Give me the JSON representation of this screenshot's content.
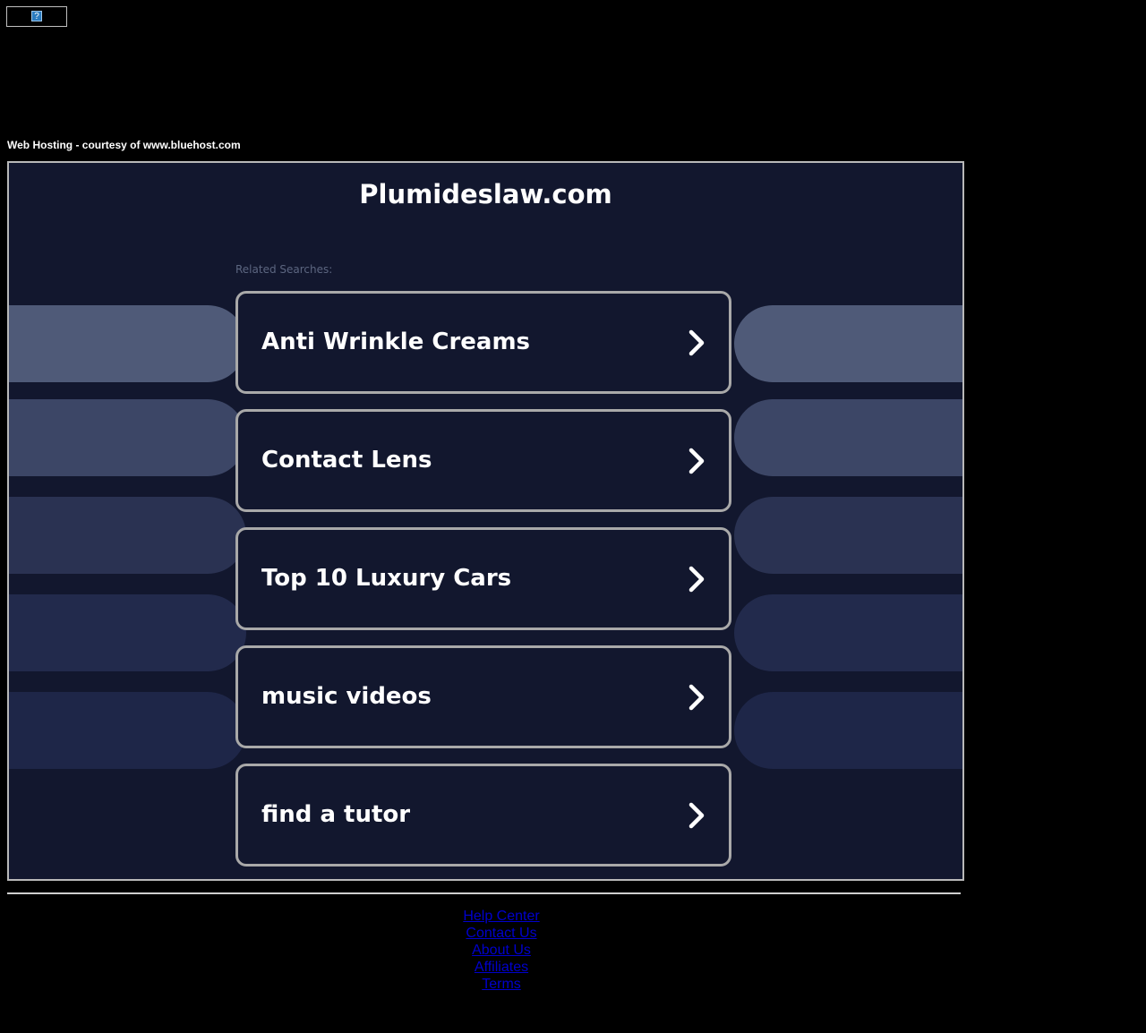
{
  "top_ad": {
    "placeholder_glyph": "?"
  },
  "hosting_note": "Web Hosting - courtesy of www.bluehost.com",
  "site_title": "Plumideslaw.com",
  "related_label": "Related Searches:",
  "searches": [
    {
      "label": "Anti Wrinkle Creams",
      "icon": "chevron-right-icon"
    },
    {
      "label": "Contact Lens",
      "icon": "chevron-right-icon"
    },
    {
      "label": "Top 10 Luxury Cars",
      "icon": "chevron-right-icon"
    },
    {
      "label": "music videos",
      "icon": "chevron-right-icon"
    },
    {
      "label": "find a tutor",
      "icon": "chevron-right-icon"
    }
  ],
  "footer": {
    "links": [
      "Help Center",
      "Contact Us",
      "About Us",
      "Affiliates",
      "Terms"
    ]
  },
  "colors": {
    "page_background": "#000000",
    "frame_background": "#12172e",
    "item_border": "#a9a9a9",
    "footer_link": "#0000cc",
    "pill_shades": [
      "#4f5a78",
      "#3c4666",
      "#2a3252",
      "#222a4c",
      "#1e2648"
    ]
  }
}
